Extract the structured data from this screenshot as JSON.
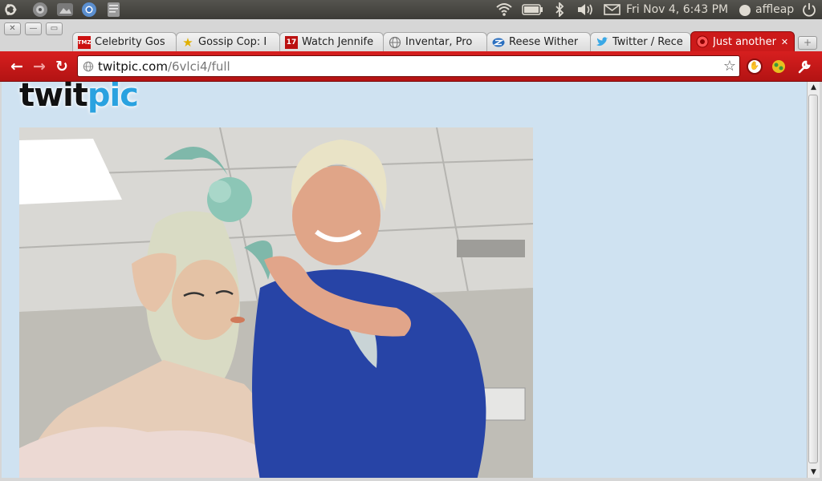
{
  "panel": {
    "clock": "Fri Nov  4,  6:43 PM",
    "user": "affleap"
  },
  "tabs": [
    {
      "title": "Celebrity Gos",
      "icon": "tmz-icon",
      "icon_text": "TMZ",
      "icon_color": "#cc1111"
    },
    {
      "title": "Gossip Cop: I",
      "icon": "star-icon",
      "icon_text": "★",
      "icon_color": "#e0b000"
    },
    {
      "title": "Watch Jennife",
      "icon": "seventeen-icon",
      "icon_text": "17",
      "icon_color": "#bb1111"
    },
    {
      "title": "Inventar, Pro",
      "icon": "globe-icon",
      "icon_text": "",
      "icon_color": "#888888"
    },
    {
      "title": "Reese Wither",
      "icon": "z-icon",
      "icon_text": "",
      "icon_color": "#2b6fbf"
    },
    {
      "title": "Twitter / Rece",
      "icon": "twitter-bird-icon",
      "icon_text": "",
      "icon_color": "#3aa8e6"
    },
    {
      "title": "Just another",
      "icon": "red-globe-icon",
      "icon_text": "",
      "icon_color": "#ff4444"
    }
  ],
  "omnibox": {
    "host": "twitpic.com",
    "path": "/6vlci4/full"
  },
  "page": {
    "logo_part1": "twit",
    "logo_part2": "pic",
    "logo_color1": "#111111",
    "logo_color2": "#2aa2e0"
  },
  "colors": {
    "chrome_theme": "#cc1a1a",
    "page_bg": "#cfe2f1"
  }
}
